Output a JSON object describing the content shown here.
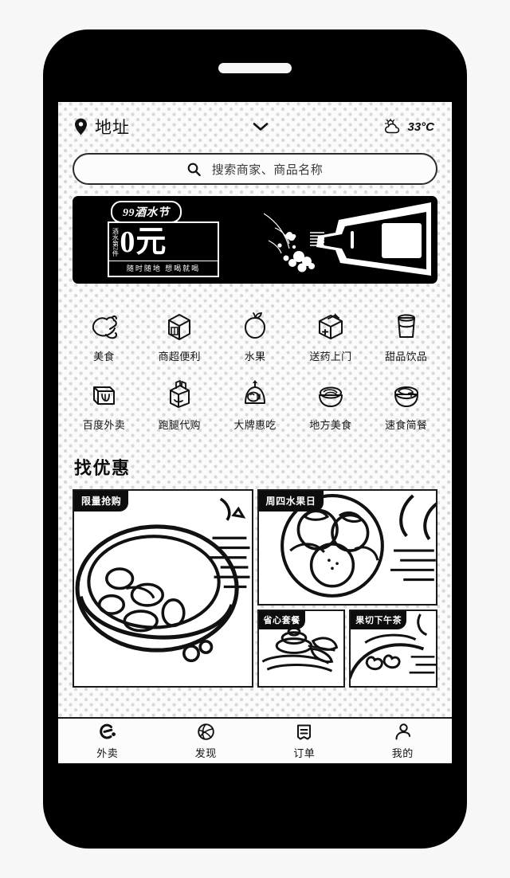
{
  "header": {
    "location_label": "地址",
    "location_icon": "location-pin-icon",
    "dropdown_icon": "chevron-down-icon",
    "weather_icon": "sun-behind-cloud-icon",
    "temperature": "33°C"
  },
  "search": {
    "icon": "search-icon",
    "placeholder": "搜索商家、商品名称",
    "value": ""
  },
  "banner": {
    "tag": "99酒水节",
    "vertical_text": "酒水第2件",
    "price": "0元",
    "subtitle": "随时随地 想喝就喝",
    "art": "wine-bottle-illustration"
  },
  "categories": [
    {
      "label": "美食",
      "icon": "roast-chicken-icon"
    },
    {
      "label": "商超便利",
      "icon": "grocery-box-icon"
    },
    {
      "label": "水果",
      "icon": "apple-icon"
    },
    {
      "label": "送药上门",
      "icon": "medicine-box-icon"
    },
    {
      "label": "甜品饮品",
      "icon": "drink-cup-icon"
    },
    {
      "label": "百度外卖",
      "icon": "takeout-box-icon"
    },
    {
      "label": "跑腿代购",
      "icon": "shopping-bag-icon"
    },
    {
      "label": "大牌惠吃",
      "icon": "bun-icon"
    },
    {
      "label": "地方美食",
      "icon": "noodle-bowl-icon"
    },
    {
      "label": "速食简餐",
      "icon": "rice-bowl-icon"
    }
  ],
  "promos": {
    "title": "找优惠",
    "cards": [
      {
        "tag": "限量抢购",
        "art": "soup-bowl-illustration"
      },
      {
        "tag": "周四水果日",
        "art": "fruit-plate-illustration"
      },
      {
        "tag": "省心套餐",
        "art": "dessert-plate-illustration"
      },
      {
        "tag": "果切下午茶",
        "art": "fruit-slices-illustration"
      }
    ]
  },
  "tabbar": {
    "items": [
      {
        "label": "外卖",
        "icon": "eleme-logo-icon",
        "active": true
      },
      {
        "label": "发现",
        "icon": "basketball-icon",
        "active": false
      },
      {
        "label": "订单",
        "icon": "order-list-icon",
        "active": false
      },
      {
        "label": "我的",
        "icon": "user-profile-icon",
        "active": false
      }
    ]
  },
  "colors": {
    "ink": "#111111",
    "paper": "#fbfbfb",
    "banner_bg": "#000000",
    "dot": "#d8d8d8"
  }
}
